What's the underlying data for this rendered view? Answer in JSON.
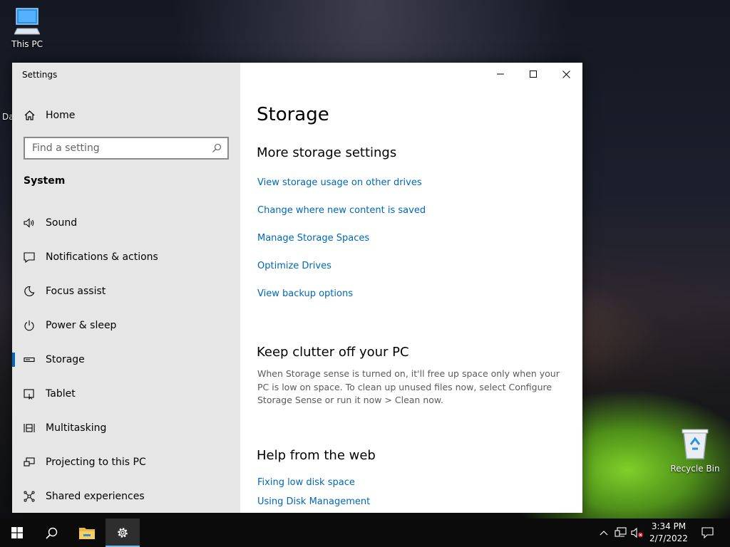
{
  "desktop": {
    "this_pc_label": "This PC",
    "recycle_bin_label": "Recycle Bin",
    "partial_icon_label": "Da"
  },
  "window": {
    "title": "Settings",
    "sidebar": {
      "home_label": "Home",
      "search_placeholder": "Find a setting",
      "section_label": "System",
      "items": [
        {
          "label": "Sound",
          "icon": "speaker-icon"
        },
        {
          "label": "Notifications & actions",
          "icon": "notification-icon"
        },
        {
          "label": "Focus assist",
          "icon": "moon-icon"
        },
        {
          "label": "Power & sleep",
          "icon": "power-icon"
        },
        {
          "label": "Storage",
          "icon": "storage-drive-icon",
          "active": true
        },
        {
          "label": "Tablet",
          "icon": "tablet-icon"
        },
        {
          "label": "Multitasking",
          "icon": "multitasking-icon"
        },
        {
          "label": "Projecting to this PC",
          "icon": "projecting-icon"
        },
        {
          "label": "Shared experiences",
          "icon": "shared-experiences-icon"
        }
      ]
    },
    "content": {
      "page_title": "Storage",
      "more_storage": {
        "heading": "More storage settings",
        "links": [
          "View storage usage on other drives",
          "Change where new content is saved",
          "Manage Storage Spaces",
          "Optimize Drives",
          "View backup options"
        ]
      },
      "clutter": {
        "heading": "Keep clutter off your PC",
        "text": "When Storage sense is turned on, it'll free up space only when your PC is low on space. To clean up unused files now, select Configure Storage Sense or run it now > Clean now."
      },
      "help": {
        "heading": "Help from the web",
        "links": [
          "Fixing low disk space",
          "Using Disk Management"
        ]
      }
    }
  },
  "taskbar": {
    "time": "3:34 PM",
    "date": "2/7/2022"
  },
  "colors": {
    "accent": "#0067c0",
    "link": "#0067b8",
    "sidebar_bg": "#e6e6e6",
    "taskbar_bg": "#0b0b0b"
  }
}
